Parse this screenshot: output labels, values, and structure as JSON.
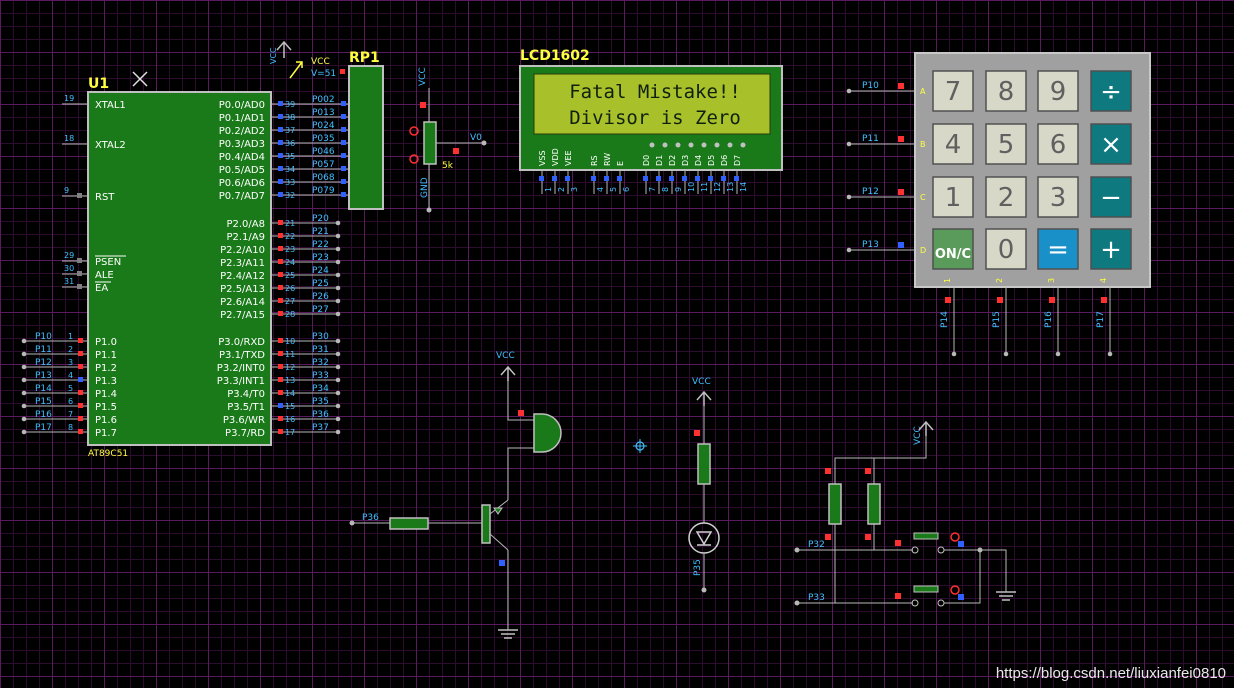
{
  "colors": {
    "component": "#1a7a1a",
    "outline": "#c0c0c0",
    "wire": "#b8b8b8",
    "label": "#ffff40",
    "netlabel": "#40c0ff",
    "red": "#ff3030",
    "blue": "#3060ff",
    "lcdbg": "#a8c02a"
  },
  "mcu": {
    "ref": "U1",
    "part": "AT89C51",
    "left_pins": [
      {
        "num": "19",
        "name": "XTAL1"
      },
      {
        "num": "18",
        "name": "XTAL2"
      },
      {
        "num": "9",
        "name": "RST"
      },
      {
        "num": "29",
        "name": "PSEN"
      },
      {
        "num": "30",
        "name": "ALE"
      },
      {
        "num": "31",
        "name": "EA"
      }
    ],
    "p1_nets": [
      "P10",
      "P11",
      "P12",
      "P13",
      "P14",
      "P15",
      "P16",
      "P17"
    ],
    "p1_nums": [
      "1",
      "2",
      "3",
      "4",
      "5",
      "6",
      "7",
      "8"
    ],
    "p1_names": [
      "P1.0",
      "P1.1",
      "P1.2",
      "P1.3",
      "P1.4",
      "P1.5",
      "P1.6",
      "P1.7"
    ],
    "p0_names": [
      "P0.0/AD0",
      "P0.1/AD1",
      "P0.2/AD2",
      "P0.3/AD3",
      "P0.4/AD4",
      "P0.5/AD5",
      "P0.6/AD6",
      "P0.7/AD7"
    ],
    "p0_nums": [
      "39",
      "38",
      "37",
      "36",
      "35",
      "34",
      "33",
      "32"
    ],
    "p0_nets": [
      "P002",
      "P013",
      "P024",
      "P035",
      "P046",
      "P057",
      "P068",
      "P079"
    ],
    "p2_names": [
      "P2.0/A8",
      "P2.1/A9",
      "P2.2/A10",
      "P2.3/A11",
      "P2.4/A12",
      "P2.5/A13",
      "P2.6/A14",
      "P2.7/A15"
    ],
    "p2_nums": [
      "21",
      "22",
      "23",
      "24",
      "25",
      "26",
      "27",
      "28"
    ],
    "p2_nets": [
      "P20",
      "P21",
      "P22",
      "P23",
      "P24",
      "P25",
      "P26",
      "P27"
    ],
    "p3_names": [
      "P3.0/RXD",
      "P3.1/TXD",
      "P3.2/INT0",
      "P3.3/INT1",
      "P3.4/T0",
      "P3.5/T1",
      "P3.6/WR",
      "P3.7/RD"
    ],
    "p3_nums": [
      "10",
      "11",
      "12",
      "13",
      "14",
      "15",
      "16",
      "17"
    ],
    "p3_nets": [
      "P30",
      "P31",
      "P32",
      "P33",
      "P34",
      "P35",
      "P36",
      "P37"
    ]
  },
  "rp1": {
    "ref": "RP1",
    "vcc": "VCC",
    "vpin": "V=51"
  },
  "pot": {
    "vcc": "VCC",
    "gnd": "GND",
    "value": "5k",
    "out": "V0"
  },
  "lcd": {
    "ref": "LCD1602",
    "line1": "Fatal Mistake!!",
    "line2": "Divisor is Zero",
    "pins": [
      "VSS",
      "VDD",
      "VEE",
      "RS",
      "RW",
      "E",
      "D0",
      "D1",
      "D2",
      "D3",
      "D4",
      "D5",
      "D6",
      "D7"
    ],
    "pin_nums": [
      "1",
      "2",
      "3",
      "4",
      "5",
      "6",
      "7",
      "8",
      "9",
      "10",
      "11",
      "12",
      "13",
      "14"
    ]
  },
  "keypad": {
    "keys": [
      [
        "7",
        "8",
        "9",
        "÷"
      ],
      [
        "4",
        "5",
        "6",
        "×"
      ],
      [
        "1",
        "2",
        "3",
        "−"
      ],
      [
        "ON/C",
        "0",
        "=",
        "+"
      ]
    ],
    "row_nets": [
      "P10",
      "P11",
      "P12",
      "P13"
    ],
    "row_letters": [
      "A",
      "B",
      "C",
      "D"
    ],
    "col_nets": [
      "P14",
      "P15",
      "P16",
      "P17"
    ],
    "col_nums": [
      "1",
      "2",
      "3",
      "4"
    ]
  },
  "buzzer": {
    "vcc": "VCC",
    "net": "P36"
  },
  "led": {
    "vcc": "VCC",
    "net": "P35"
  },
  "buttons": {
    "vcc": "VCC",
    "nets": [
      "P32",
      "P33"
    ]
  },
  "watermark": "https://blog.csdn.net/liuxianfei0810"
}
